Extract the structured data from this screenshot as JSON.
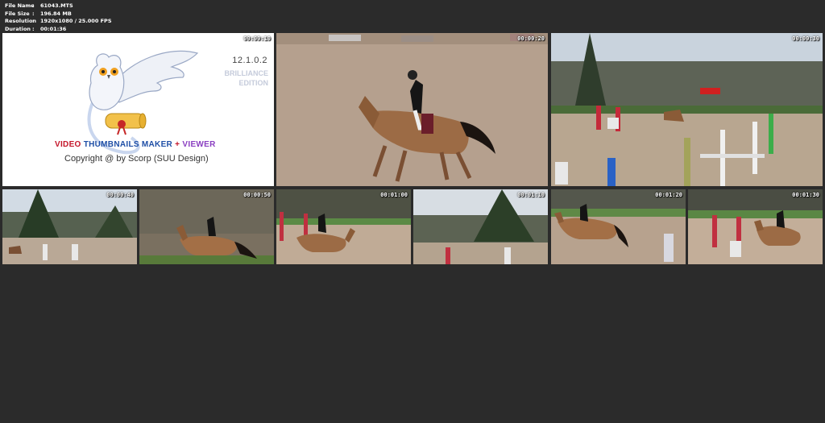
{
  "file_info": [
    {
      "key": "File Name",
      "value": "61043.MTS"
    },
    {
      "key": "File Size",
      "value": "196.84 MB"
    },
    {
      "key": "Resolution",
      "value": "1920x1080 / 25.000 FPS"
    },
    {
      "key": "Duration",
      "value": "00:01:36"
    }
  ],
  "separator": ":",
  "logo": {
    "version": "12.1.0.2",
    "edition_line1": "BRILLIANCE",
    "edition_line2": "EDITION",
    "product_part1": "VIDEO",
    "product_part2": "THUMBNAILS MAKER",
    "product_part3": "+",
    "product_part4": "VIEWER",
    "copyright": "Copyright @ by Scorp (SUU Design)"
  },
  "thumbnails": [
    {
      "timestamp": "00:00:10"
    },
    {
      "timestamp": "00:00:20"
    },
    {
      "timestamp": "00:00:30"
    },
    {
      "timestamp": "00:00:40"
    },
    {
      "timestamp": "00:00:50"
    },
    {
      "timestamp": "00:01:00"
    },
    {
      "timestamp": "00:01:10"
    },
    {
      "timestamp": "00:01:20"
    },
    {
      "timestamp": "00:01:30"
    }
  ],
  "colors": {
    "background": "#2b2b2b",
    "sand": "#b79f8c",
    "horse": "#9c6b45",
    "product_red": "#c4162a",
    "product_blue": "#1f4fa6",
    "product_purple": "#8a3fc1"
  }
}
